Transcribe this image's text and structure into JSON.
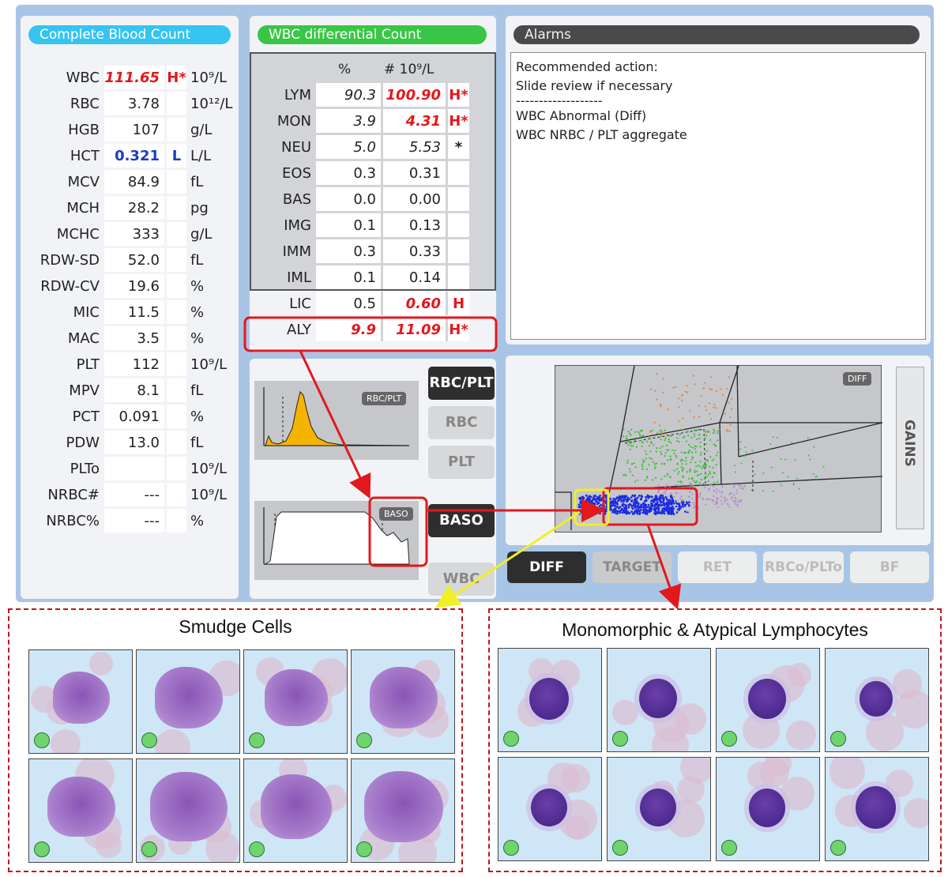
{
  "cbc": {
    "title": "Complete Blood Count",
    "rows": [
      {
        "name": "WBC",
        "value": "111.65",
        "flag": "H*",
        "unit": "10⁹/L",
        "state": "high"
      },
      {
        "name": "RBC",
        "value": "3.78",
        "flag": "",
        "unit": "10¹²/L",
        "state": ""
      },
      {
        "name": "HGB",
        "value": "107",
        "flag": "",
        "unit": "g/L",
        "state": ""
      },
      {
        "name": "HCT",
        "value": "0.321",
        "flag": "L",
        "unit": "L/L",
        "state": "low"
      },
      {
        "name": "MCV",
        "value": "84.9",
        "flag": "",
        "unit": "fL",
        "state": ""
      },
      {
        "name": "MCH",
        "value": "28.2",
        "flag": "",
        "unit": "pg",
        "state": ""
      },
      {
        "name": "MCHC",
        "value": "333",
        "flag": "",
        "unit": "g/L",
        "state": ""
      },
      {
        "name": "RDW-SD",
        "value": "52.0",
        "flag": "",
        "unit": "fL",
        "state": ""
      },
      {
        "name": "RDW-CV",
        "value": "19.6",
        "flag": "",
        "unit": "%",
        "state": ""
      },
      {
        "name": "MIC",
        "value": "11.5",
        "flag": "",
        "unit": "%",
        "state": ""
      },
      {
        "name": "MAC",
        "value": "3.5",
        "flag": "",
        "unit": "%",
        "state": ""
      },
      {
        "name": "PLT",
        "value": "112",
        "flag": "",
        "unit": "10⁹/L",
        "state": ""
      },
      {
        "name": "MPV",
        "value": "8.1",
        "flag": "",
        "unit": "fL",
        "state": ""
      },
      {
        "name": "PCT",
        "value": "0.091",
        "flag": "",
        "unit": "%",
        "state": ""
      },
      {
        "name": "PDW",
        "value": "13.0",
        "flag": "",
        "unit": "fL",
        "state": ""
      },
      {
        "name": "PLTo",
        "value": "",
        "flag": "",
        "unit": "10⁹/L",
        "state": ""
      },
      {
        "name": "NRBC#",
        "value": "---",
        "flag": "",
        "unit": "10⁹/L",
        "state": ""
      },
      {
        "name": "NRBC%",
        "value": "---",
        "flag": "",
        "unit": "%",
        "state": ""
      }
    ]
  },
  "diff": {
    "title": "WBC differential Count",
    "col_pct": "%",
    "col_abs": "# 10⁹/L",
    "rows": [
      {
        "name": "LYM",
        "pct": "90.3",
        "abs": "100.90",
        "flag": "H*",
        "state": "high"
      },
      {
        "name": "MON",
        "pct": "3.9",
        "abs": "4.31",
        "flag": "H*",
        "state": "high"
      },
      {
        "name": "NEU",
        "pct": "5.0",
        "abs": "5.53",
        "flag": "*",
        "state": "star"
      },
      {
        "name": "EOS",
        "pct": "0.3",
        "abs": "0.31",
        "flag": "",
        "state": ""
      },
      {
        "name": "BAS",
        "pct": "0.0",
        "abs": "0.00",
        "flag": "",
        "state": ""
      },
      {
        "name": "IMG",
        "pct": "0.1",
        "abs": "0.13",
        "flag": "",
        "state": ""
      },
      {
        "name": "IMM",
        "pct": "0.3",
        "abs": "0.33",
        "flag": "",
        "state": ""
      },
      {
        "name": "IML",
        "pct": "0.1",
        "abs": "0.14",
        "flag": "",
        "state": ""
      },
      {
        "name": "LIC",
        "pct": "0.5",
        "abs": "0.60",
        "flag": "H",
        "state": "lic"
      },
      {
        "name": "ALY",
        "pct": "9.9",
        "abs": "11.09",
        "flag": "H*",
        "state": "aly"
      }
    ]
  },
  "alarms": {
    "title": "Alarms",
    "lines": [
      "Recommended action:",
      "Slide review if necessary",
      "-------------------",
      "WBC Abnormal (Diff)",
      "WBC NRBC / PLT aggregate"
    ]
  },
  "histograms": {
    "rbc_plt_badge": "RBC/PLT",
    "baso_badge": "BASO",
    "buttons": {
      "rbc_plt": "RBC/PLT",
      "rbc": "RBC",
      "plt": "PLT",
      "baso": "BASO",
      "wbc": "WBC"
    }
  },
  "scatter": {
    "badge": "DIFF",
    "gains": "GAINS"
  },
  "tabs": {
    "diff": "DIFF",
    "target": "TARGET",
    "ret": "RET",
    "rbco_plto": "RBCo/PLTo",
    "bf": "BF"
  },
  "sections": {
    "smudge_title": "Smudge Cells",
    "lymph_title": "Monomorphic & Atypical Lymphocytes"
  },
  "colors": {
    "cbc_pill": "#36c4f1",
    "diff_pill": "#39c646",
    "alarm_pill": "#4a4a4a",
    "flag_high": "#e3181c",
    "flag_low": "#1c3cc4",
    "histogram_fill": "#f5b400",
    "highlight_red": "#e3181c",
    "highlight_yellow": "#f2ee27"
  }
}
